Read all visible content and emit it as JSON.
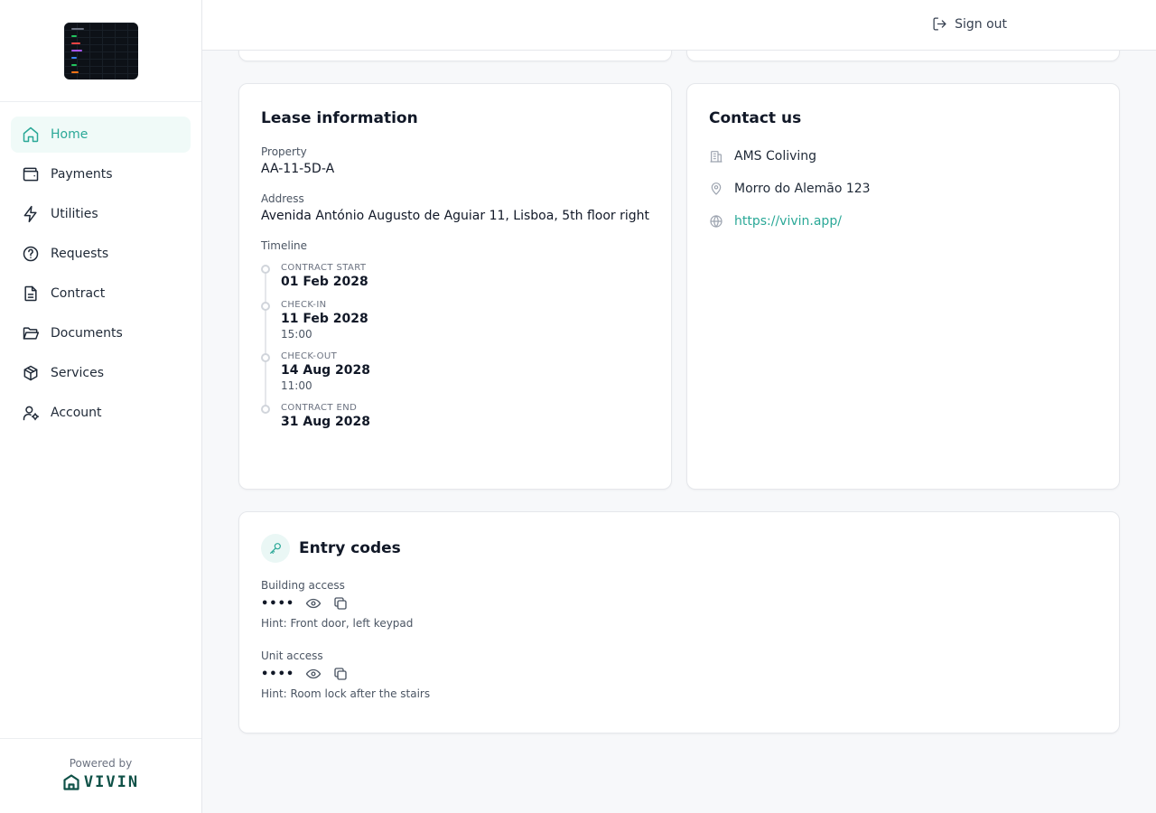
{
  "header": {
    "signout_label": "Sign out"
  },
  "sidebar": {
    "items": [
      {
        "label": "Home",
        "icon": "home-icon",
        "active": true
      },
      {
        "label": "Payments",
        "icon": "wallet-icon"
      },
      {
        "label": "Utilities",
        "icon": "bolt-icon"
      },
      {
        "label": "Requests",
        "icon": "help-circle-icon"
      },
      {
        "label": "Contract",
        "icon": "file-text-icon"
      },
      {
        "label": "Documents",
        "icon": "folder-open-icon"
      },
      {
        "label": "Services",
        "icon": "package-icon"
      },
      {
        "label": "Account",
        "icon": "user-cog-icon"
      }
    ],
    "powered_by": "Powered by",
    "brand": "VIVIN"
  },
  "lease": {
    "title": "Lease information",
    "property_label": "Property",
    "property_value": "AA-11-5D-A",
    "address_label": "Address",
    "address_value": "Avenida António Augusto de Aguiar 11, Lisboa, 5th floor right",
    "timeline_label": "Timeline",
    "timeline": [
      {
        "label": "CONTRACT START",
        "date": "01 Feb 2028",
        "time": ""
      },
      {
        "label": "CHECK-IN",
        "date": "11 Feb 2028",
        "time": "15:00"
      },
      {
        "label": "CHECK-OUT",
        "date": "14 Aug 2028",
        "time": "11:00"
      },
      {
        "label": "CONTRACT END",
        "date": "31 Aug 2028",
        "time": ""
      }
    ]
  },
  "contact": {
    "title": "Contact us",
    "company": "AMS Coliving",
    "address": "Morro do Alemão 123",
    "website": "https://vivin.app/"
  },
  "entry": {
    "title": "Entry codes",
    "codes": [
      {
        "label": "Building access",
        "masked": "••••",
        "hint": "Hint: Front door, left keypad"
      },
      {
        "label": "Unit access",
        "masked": "••••",
        "hint": "Hint: Room lock after the stairs"
      }
    ]
  },
  "colors": {
    "accent": "#2aa897",
    "accent_bg": "#f0faf8",
    "brand_dark": "#0f5147"
  }
}
